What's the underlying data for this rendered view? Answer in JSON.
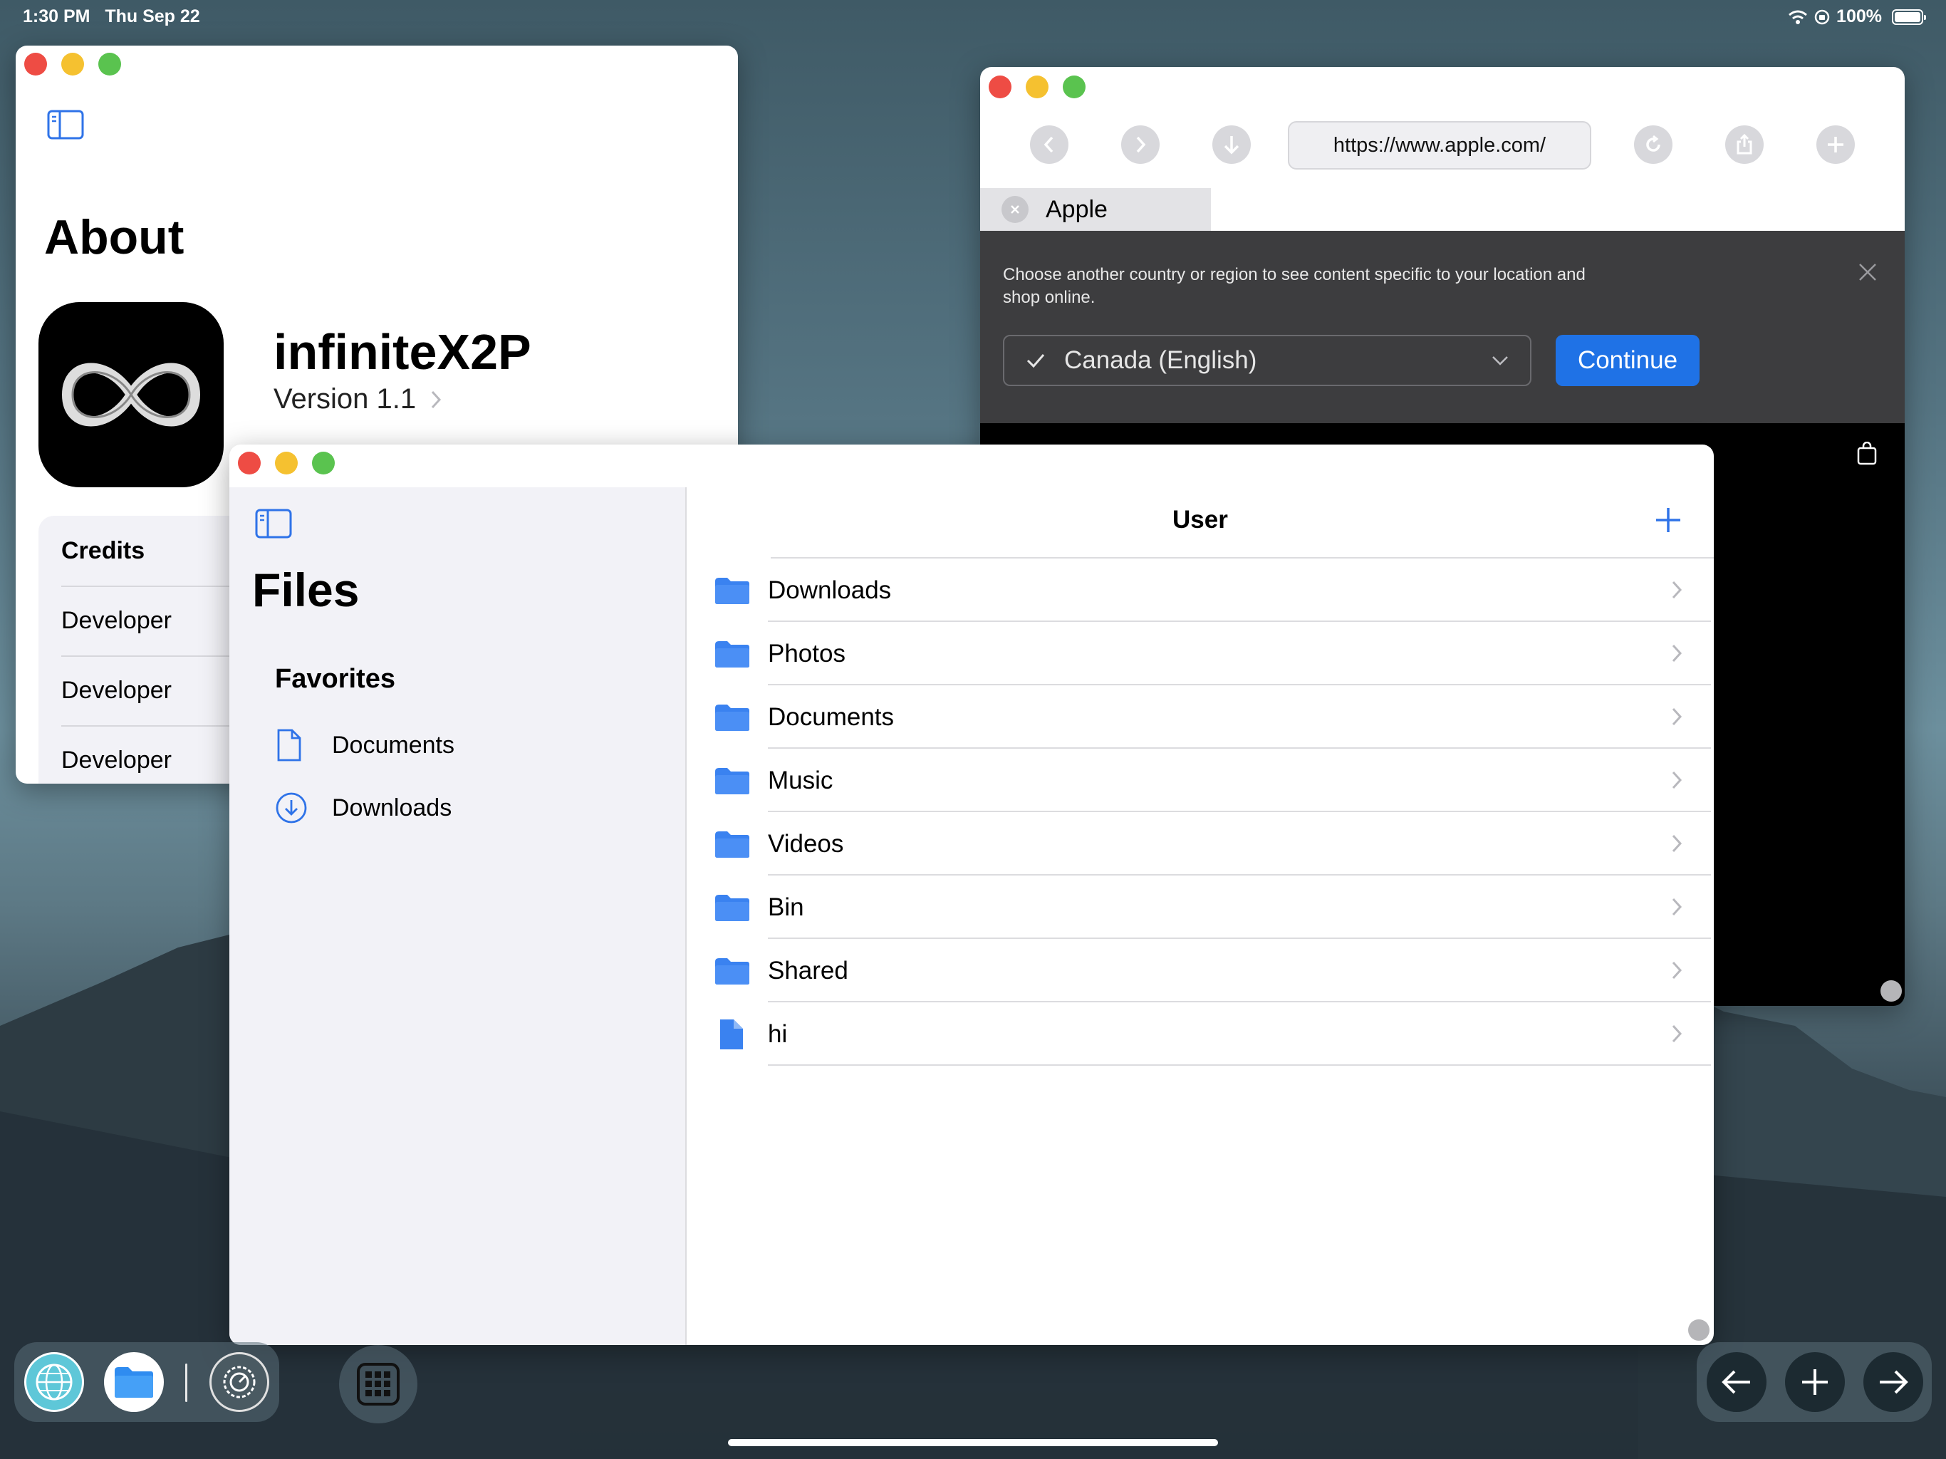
{
  "status_bar": {
    "time": "1:30 PM",
    "date": "Thu Sep 22",
    "battery": "100%"
  },
  "about_window": {
    "title": "About",
    "app_name": "infiniteX2P",
    "version": "Version 1.1",
    "credits_header": "Credits",
    "credits": [
      "Developer",
      "Developer",
      "Developer"
    ]
  },
  "safari_window": {
    "url": "https://www.apple.com/",
    "tab_title": "Apple",
    "banner_text_line1": "Choose another country or region to see content specific to your location and",
    "banner_text_line2": "shop online.",
    "region_selected": "Canada (English)",
    "continue_label": "Continue"
  },
  "files_window": {
    "sidebar_title": "Files",
    "favorites_header": "Favorites",
    "favorites": [
      {
        "label": "Documents",
        "icon": "document-icon"
      },
      {
        "label": "Downloads",
        "icon": "download-circle-icon"
      }
    ],
    "header_title": "User",
    "items": [
      {
        "label": "Downloads",
        "icon": "folder-icon"
      },
      {
        "label": "Photos",
        "icon": "folder-icon"
      },
      {
        "label": "Documents",
        "icon": "folder-icon"
      },
      {
        "label": "Music",
        "icon": "folder-icon"
      },
      {
        "label": "Videos",
        "icon": "folder-icon"
      },
      {
        "label": "Bin",
        "icon": "folder-icon"
      },
      {
        "label": "Shared",
        "icon": "folder-icon"
      },
      {
        "label": "hi",
        "icon": "file-icon"
      }
    ]
  },
  "dock": {
    "apps": [
      "globe-icon",
      "files-app-icon",
      "settings-icon"
    ],
    "grid": "app-grid-icon",
    "controls": [
      "arrow-left-icon",
      "plus-icon",
      "arrow-right-icon"
    ]
  },
  "colors": {
    "accent": "#2f73e8",
    "folder": "#3a82f0",
    "close": "#ee4c44",
    "minimize": "#f5c130",
    "zoom": "#5ac34f"
  }
}
